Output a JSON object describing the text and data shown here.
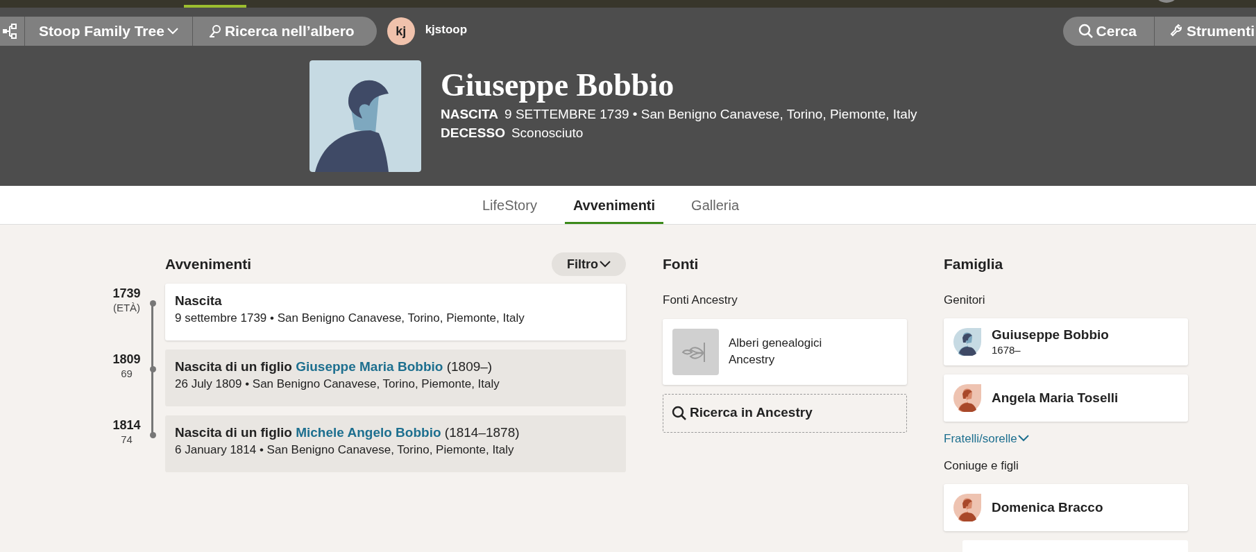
{
  "top_nav": {
    "tree_menu": "Stoop Family Tree",
    "tree_search": "Ricerca nell’albero",
    "user": {
      "initials": "kj",
      "name": "kjstoop"
    },
    "search_button": "Cerca",
    "tools_button": "Strumenti"
  },
  "profile": {
    "name": "Giuseppe Bobbio",
    "facts": [
      {
        "label": "NASCITA",
        "value": "9 SETTEMBRE 1739 • San Benigno Canavese, Torino, Piemonte, Italy"
      },
      {
        "label": "DECESSO",
        "value": "Sconosciuto"
      }
    ]
  },
  "tabs": [
    {
      "label": "LifeStory",
      "selected": false
    },
    {
      "label": "Avvenimenti",
      "selected": true
    },
    {
      "label": "Galleria",
      "selected": false
    }
  ],
  "events": {
    "title": "Avvenimenti",
    "filter_button": "Filtro",
    "items": [
      {
        "kind": "personal",
        "year": "1739",
        "age": "(ETÀ)",
        "title": "Nascita",
        "detail": "9 settembre 1739 • San Benigno Canavese, Torino, Piemonte, Italy"
      },
      {
        "kind": "family",
        "year": "1809",
        "age": "69",
        "title": "Nascita di un figlio",
        "link": "Giuseppe Maria Bobbio",
        "dates": "(1809–)",
        "detail": "26 July 1809 • San Benigno Canavese, Torino, Piemonte, Italy"
      },
      {
        "kind": "family",
        "year": "1814",
        "age": "74",
        "title": "Nascita di un figlio",
        "link": "Michele Angelo Bobbio",
        "dates": "(1814–1878)",
        "detail": "6 January 1814 • San Benigno Canavese, Torino, Piemonte, Italy"
      }
    ]
  },
  "sources": {
    "title": "Fonti",
    "section": "Fonti Ancestry",
    "cards": [
      {
        "label": "Alberi genealogici Ancestry"
      }
    ],
    "search_button": "Ricerca in Ancestry"
  },
  "family": {
    "title": "Famiglia",
    "parents_label": "Genitori",
    "parents": [
      {
        "kind": "male",
        "name": "Guiuseppe Bobbio",
        "years": "1678–"
      },
      {
        "kind": "female",
        "name": "Angela Maria Toselli"
      }
    ],
    "siblings_toggle": "Fratelli/sorelle",
    "spouse_label": "Coniuge e figli",
    "spouses": [
      {
        "kind": "female",
        "name": "Domenica Bracco"
      }
    ]
  }
}
